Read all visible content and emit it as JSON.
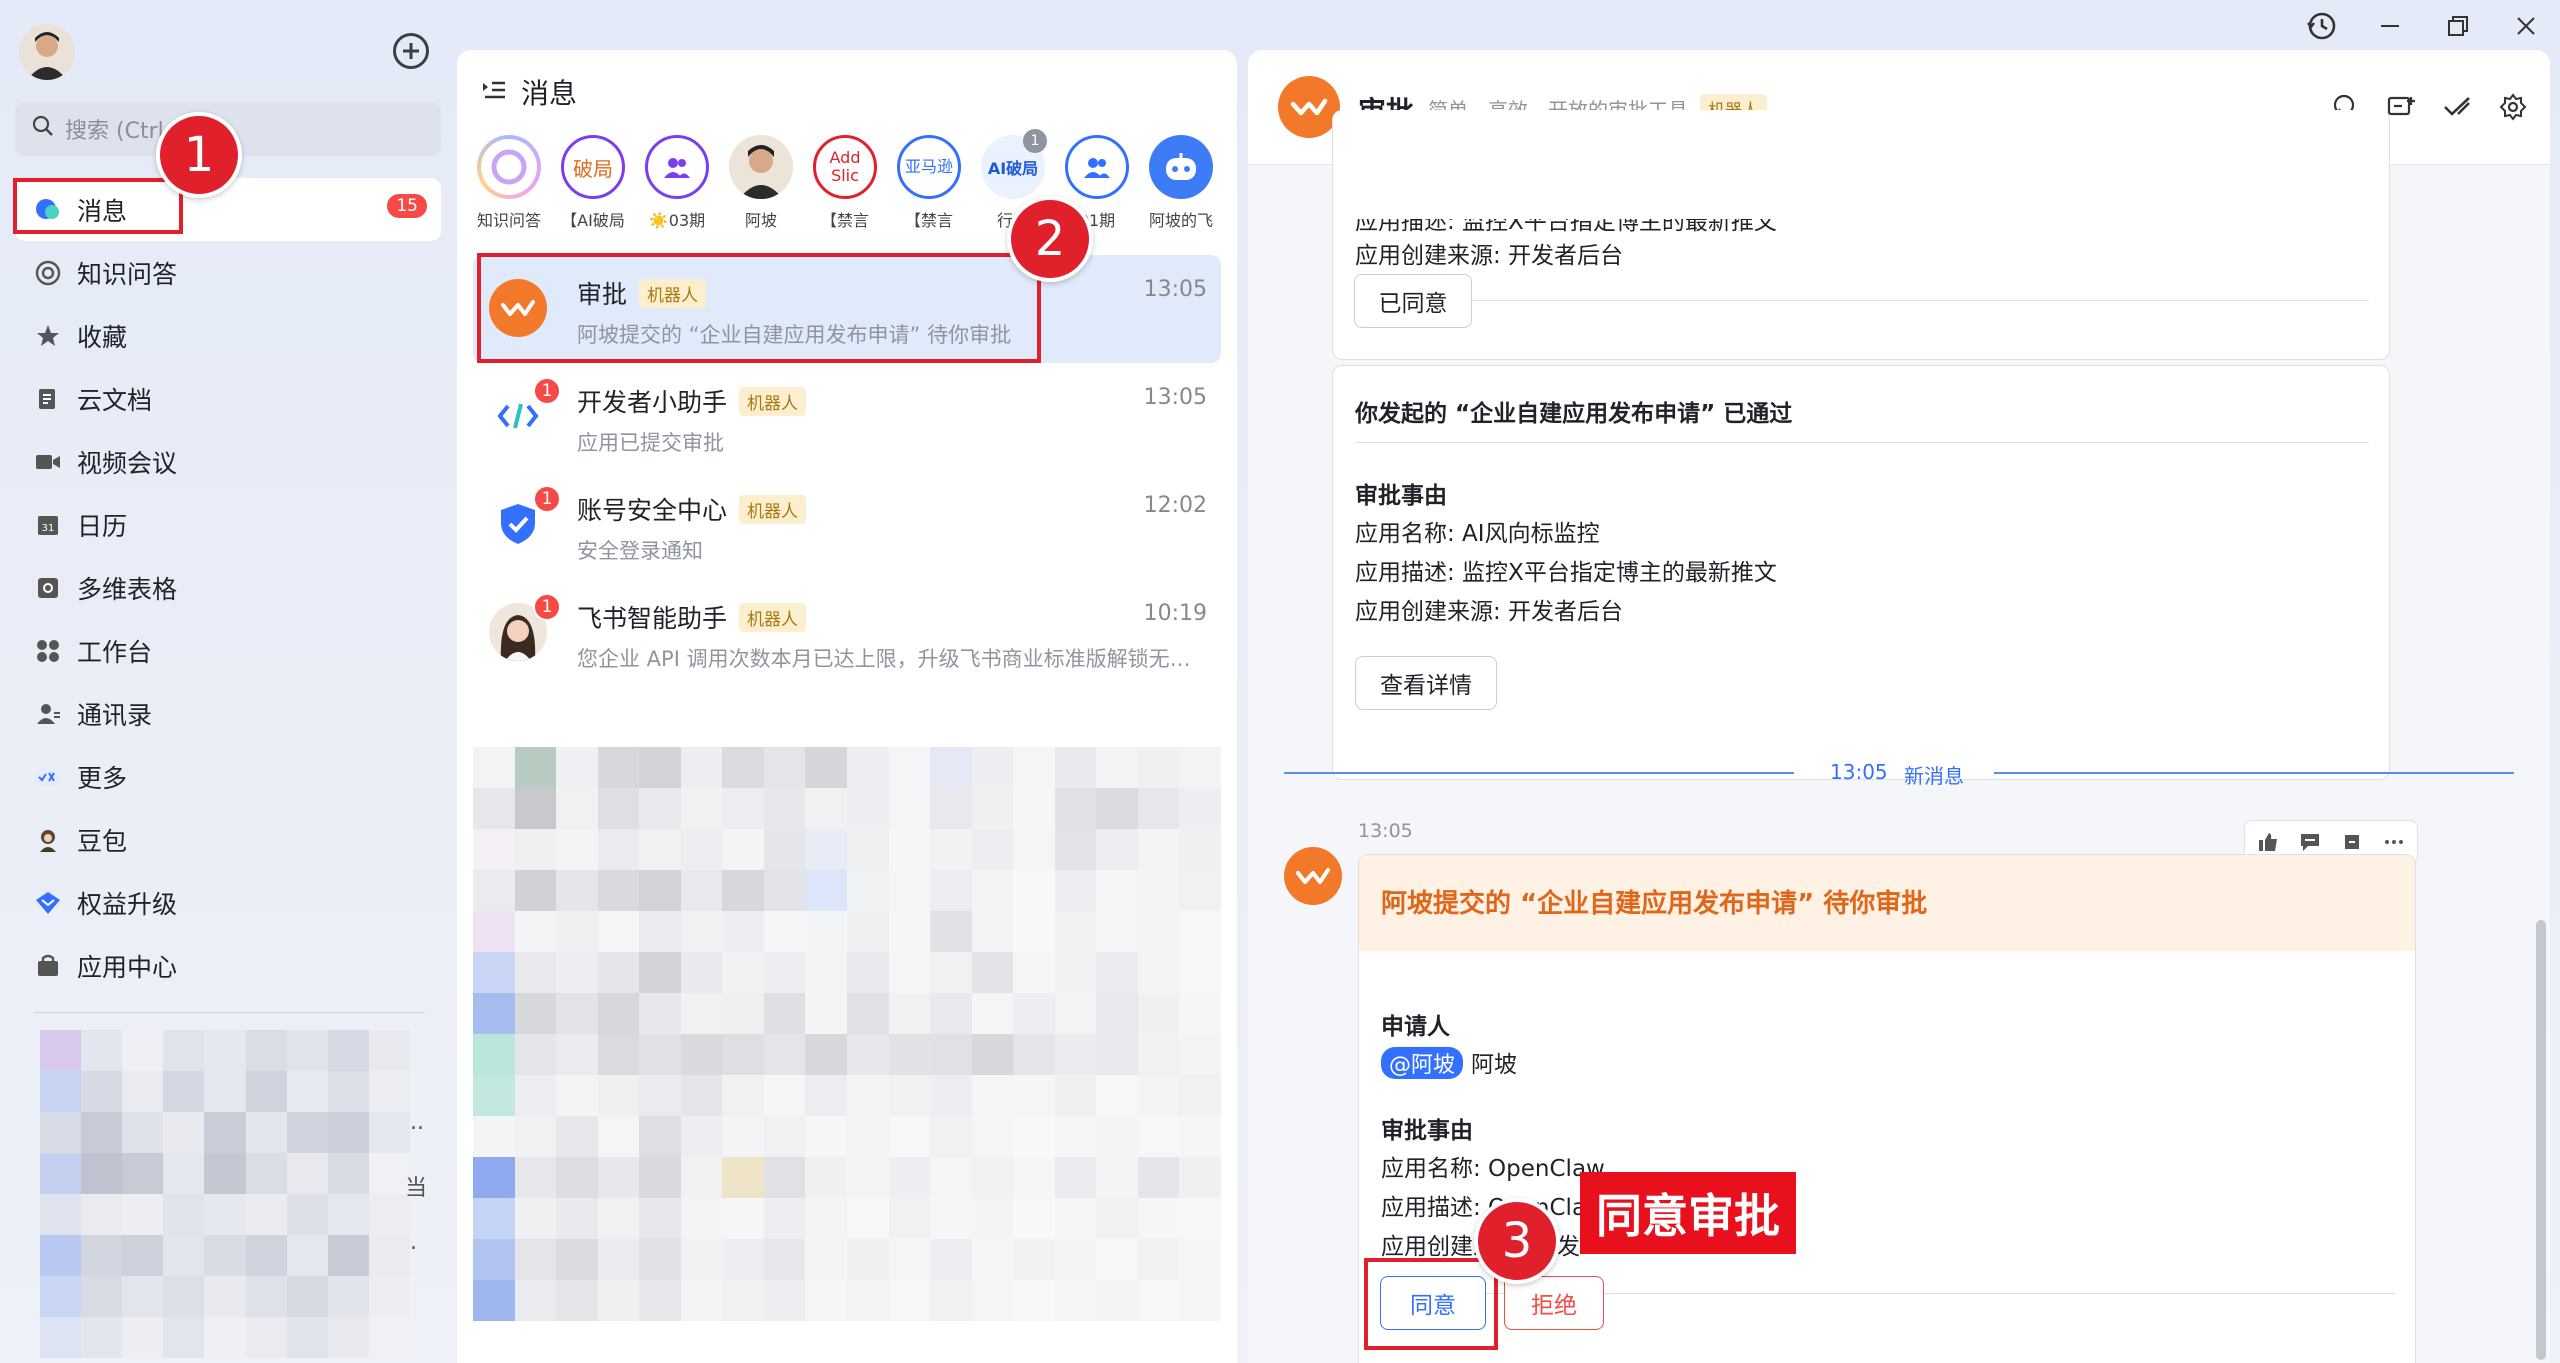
{
  "sidebar": {
    "search_placeholder": "搜索 (Ctrl",
    "items": [
      {
        "label": "消息",
        "icon": "chat-bubble-icon",
        "count": "15"
      },
      {
        "label": "知识问答",
        "icon": "knowledge-qa-icon"
      },
      {
        "label": "收藏",
        "icon": "star-icon"
      },
      {
        "label": "云文档",
        "icon": "cloud-doc-icon"
      },
      {
        "label": "视频会议",
        "icon": "video-icon"
      },
      {
        "label": "日历",
        "icon": "calendar-icon"
      },
      {
        "label": "多维表格",
        "icon": "base-table-icon"
      },
      {
        "label": "工作台",
        "icon": "workplace-icon"
      },
      {
        "label": "通讯录",
        "icon": "contacts-icon"
      },
      {
        "label": "更多",
        "icon": "more-apps-icon"
      },
      {
        "label": "豆包",
        "icon": "doubao-icon"
      },
      {
        "label": "权益升级",
        "icon": "upgrade-icon"
      },
      {
        "label": "应用中心",
        "icon": "app-center-icon"
      }
    ],
    "hint_ellipsis": "..",
    "hint_text": "当",
    "hint_dot": "."
  },
  "annotations": {
    "step1": "1",
    "step2": "2",
    "step3": "3",
    "callout": "同意审批"
  },
  "middle": {
    "title": "消息",
    "stories": [
      {
        "label": "知识问答",
        "ring_text": ""
      },
      {
        "label": "【AI破局",
        "ring_text": "破局"
      },
      {
        "label": "☀️03期",
        "ring_text": ""
      },
      {
        "label": "阿坡",
        "ring_text": ""
      },
      {
        "label": "【禁言",
        "ring_text": "Add Slic"
      },
      {
        "label": "【禁言",
        "ring_text": "亚马逊"
      },
      {
        "label": "行动",
        "ring_text": "AI破局",
        "badge": "1"
      },
      {
        "label": "01期",
        "ring_text": ""
      },
      {
        "label": "阿坡的飞",
        "ring_text": ""
      }
    ],
    "chats": [
      {
        "name": "审批",
        "tag": "机器人",
        "time": "13:05",
        "preview": "阿坡提交的 “企业自建应用发布申请” 待你审批"
      },
      {
        "name": "开发者小助手",
        "tag": "机器人",
        "time": "13:05",
        "preview": "应用已提交审批",
        "badge": "1"
      },
      {
        "name": "账号安全中心",
        "tag": "机器人",
        "time": "12:02",
        "preview": "安全登录通知",
        "badge": "1"
      },
      {
        "name": "飞书智能助手",
        "tag": "机器人",
        "time": "10:19",
        "preview": "您企业 API 调用次数本月已达上限，升级飞书商业标准版解锁无限...",
        "badge": "1"
      }
    ]
  },
  "chat": {
    "title": "审批",
    "subtitle": "简单、高效、开放的审批工具",
    "tag": "机器人",
    "card1": {
      "line_partial": "应用描述: 监控X平台指定博主的最新推文",
      "line_source": "应用创建来源: 开发者后台",
      "button": "已同意"
    },
    "card2": {
      "title": "你发起的 “企业自建应用发布申请” 已通过",
      "section": "审批事由",
      "app_name": "应用名称: AI风向标监控",
      "app_desc": "应用描述: 监控X平台指定博主的最新推文",
      "app_source": "应用创建来源: 开发者后台",
      "button": "查看详情"
    },
    "divider_time": "13:05",
    "divider_label": "新消息",
    "message_time": "13:05",
    "card3": {
      "header": "阿坡提交的 “企业自建应用发布申请” 待你审批",
      "applicant_label": "申请人",
      "applicant_mention": "@阿坡",
      "applicant_name": "阿坡",
      "section": "审批事由",
      "app_name": "应用名称: OpenClaw",
      "app_desc": "应用描述: OpenClaw 聊天机器人",
      "app_source": "应用创建来源: 开发",
      "agree": "同意",
      "reject": "拒绝"
    }
  },
  "colors": {
    "accent": "#3370ff",
    "brand_orange": "#f3792a",
    "annotation_red": "#e0212c",
    "badge_red": "#f54a45"
  }
}
